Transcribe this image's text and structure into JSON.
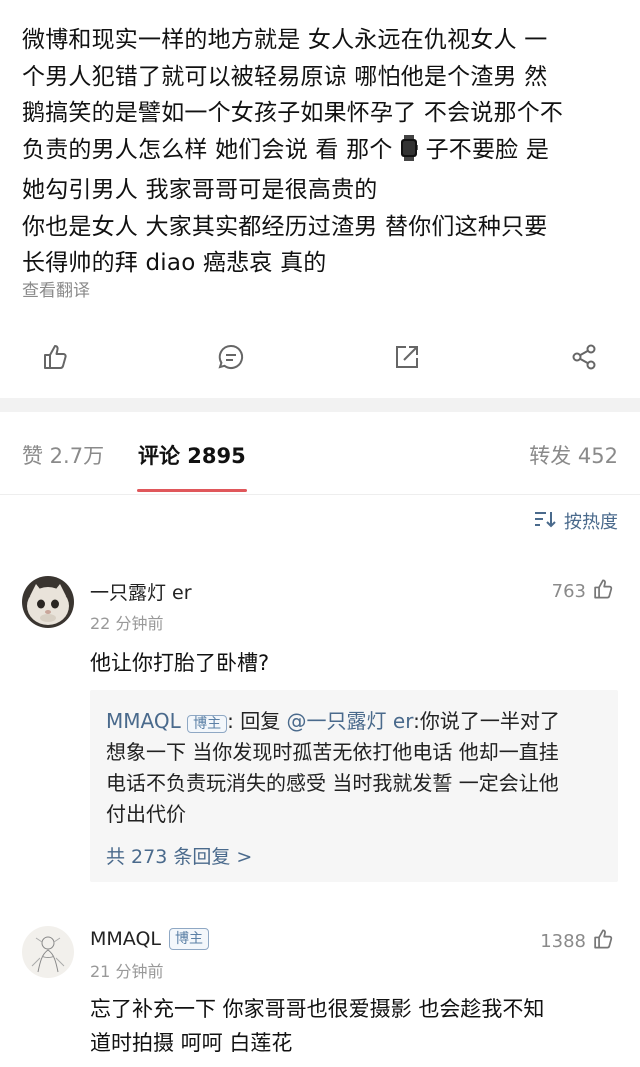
{
  "post": {
    "lines": [
      "微博和现实一样的地方就是  女人永远在仇视女人  一",
      "个男人犯错了就可以被轻易原谅 哪怕他是个渣男  然",
      "鹅搞笑的是譬如一个女孩子如果怀孕了 不会说那个不",
      "负责的男人怎么样 她们会说 看 那个",
      "子不要脸  是",
      "她勾引男人 我家哥哥可是很高贵的",
      "你也是女人 大家其实都经历过渣男  替你们这种只要",
      "长得帅的拜 diao 癌悲哀  真的"
    ],
    "translate_label": "查看翻译",
    "inline_emoji": "watch-icon"
  },
  "actions": {
    "like_icon": "thumbs-up-icon",
    "comment_icon": "comment-icon",
    "repost_icon": "repost-icon",
    "share_icon": "share-icon"
  },
  "tabs": {
    "likes": "赞 2.7万",
    "comments": "评论 2895",
    "reposts": "转发 452"
  },
  "sort": {
    "icon": "sort-icon",
    "label": "按热度"
  },
  "comments": [
    {
      "name": "一只露灯 er",
      "time": "22 分钟前",
      "likes": "763",
      "text": "他让你打胎了卧槽?",
      "reply": {
        "author": "MMAQL",
        "badge": "博主",
        "prefix": ": 回复 ",
        "mention": "@一只露灯 er",
        "lines": [
          ":你说了一半对了",
          "想象一下 当你发现时孤苦无依打他电话 他却一直挂",
          "电话不负责玩消失的感受 当时我就发誓 一定会让他",
          "付出代价"
        ],
        "more": "共 273 条回复 >"
      }
    },
    {
      "name": "MMAQL",
      "badge": "博主",
      "time": "21 分钟前",
      "likes": "1388",
      "lines": [
        "忘了补充一下 你家哥哥也很爱摄影 也会趁我不知",
        "道时拍摄 呵呵 白莲花"
      ]
    }
  ],
  "colors": {
    "accent": "#e0575b",
    "link": "#4a6a8c",
    "muted": "#8a8a8a"
  }
}
